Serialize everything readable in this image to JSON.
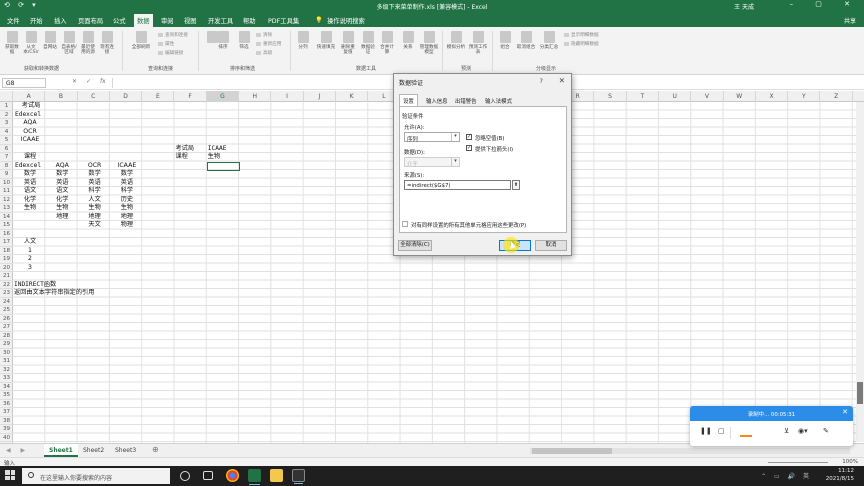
{
  "window": {
    "title": "多级下来菜单制作.xls [兼容模式] - Excel",
    "user": "王 天成",
    "quick_access": "⟲ ⟳ ▾",
    "controls": "– ▢ ✕"
  },
  "menu": {
    "tabs": [
      "文件",
      "开始",
      "插入",
      "页面布局",
      "公式",
      "数据",
      "审阅",
      "视图",
      "开发工具",
      "帮助",
      "PDF工具集"
    ],
    "active_tab": "数据",
    "tell_me": "操作说明搜索",
    "share": "共享"
  },
  "ribbon": {
    "buttons": [
      "获取数据",
      "从文本/CSV",
      "自网站",
      "自表格/区域",
      "最近使用的源",
      "现有连接",
      "全部刷新",
      "排序",
      "筛选",
      "分列",
      "快速填充",
      "删除重复值",
      "数据验证",
      "合并计算",
      "关系",
      "管理数据模型",
      "模拟分析",
      "预测工作表",
      "组合",
      "取消组合",
      "分类汇总"
    ],
    "small_items": [
      "查询和连接",
      "属性",
      "编辑链接",
      "清除",
      "重新应用",
      "高级",
      "显示明细数据",
      "隐藏明细数据"
    ],
    "groups": [
      "获取和转换数据",
      "查询和连接",
      "排序和筛选",
      "数据工具",
      "预测",
      "分级显示"
    ]
  },
  "formula_bar": {
    "name_box": "G8",
    "cancel": "✕",
    "enter": "✓",
    "fx": "fx",
    "content": ""
  },
  "grid": {
    "columns": [
      "A",
      "B",
      "C",
      "D",
      "E",
      "F",
      "G",
      "H",
      "I",
      "J",
      "K",
      "L",
      "M",
      "N",
      "O",
      "P",
      "Q",
      "R",
      "S",
      "T",
      "U",
      "V",
      "W",
      "X",
      "Y",
      "Z"
    ],
    "selected_column": "G",
    "rows": [
      "1",
      "2",
      "3",
      "4",
      "5",
      "6",
      "7",
      "8",
      "9",
      "10",
      "11",
      "12",
      "13",
      "14",
      "15",
      "16",
      "17",
      "18",
      "19",
      "20",
      "21",
      "22",
      "23",
      "24",
      "25",
      "26",
      "27",
      "28",
      "29",
      "30",
      "31",
      "32",
      "33",
      "34",
      "35",
      "36",
      "37",
      "38",
      "39",
      "40"
    ],
    "cells": {
      "A1": "考试局",
      "A2": "Edexcel",
      "A3": "AQA",
      "A4": "OCR",
      "A5": "ICAAE",
      "A7": "课程",
      "A8": "Edexcel",
      "B8": "AQA",
      "C8": "OCR",
      "D8": "ICAAE",
      "A9": "数学",
      "B9": "数学",
      "C9": "数学",
      "D9": "数学",
      "A10": "英语",
      "B10": "英语",
      "C10": "英语",
      "D10": "英语",
      "A11": "语文",
      "B11": "语文",
      "C11": "科学",
      "D11": "科学",
      "A12": "化学",
      "B12": "化学",
      "C12": "人文",
      "D12": "历史",
      "A13": "生物",
      "B13": "生物",
      "C13": "生物",
      "D13": "生物",
      "B14": "地理",
      "C14": "地理",
      "D14": "地理",
      "C15": "天文",
      "D15": "物理",
      "A17": "人文",
      "A18": "1",
      "A19": "2",
      "A20": "3",
      "A22": "INDIRECT函数",
      "A23": "返回由文本字符串指定的引用",
      "F6": "考试局",
      "G6": "ICAAE",
      "F7": "课程",
      "G7": "生物"
    }
  },
  "sheets": {
    "tabs": [
      "Sheet1",
      "Sheet2",
      "Sheet3"
    ],
    "active": "Sheet1",
    "add": "⊕",
    "nav": "◀ ▶"
  },
  "status": {
    "mode": "输入",
    "zoom": "100%"
  },
  "dialog": {
    "title": "数据验证",
    "help": "?",
    "close": "✕",
    "tabs": [
      "设置",
      "输入信息",
      "出错警告",
      "输入法模式"
    ],
    "active_tab": "设置",
    "section_label": "验证条件",
    "allow_label": "允许(A):",
    "allow_value": "序列",
    "ignore_blank_label": "忽略空值(B)",
    "ignore_blank": true,
    "dropdown_label": "提供下拉箭头(I)",
    "dropdown": true,
    "data_label": "数据(D):",
    "data_value": "介于",
    "source_label": "来源(S):",
    "source_value": "=indirect($G$7)",
    "apply_all_label": "对有同样设置的所有其他单元格应用这些更改(P)",
    "apply_all": false,
    "clear_all": "全部清除(C)",
    "ok": "确定",
    "cancel": "取消"
  },
  "recorder": {
    "status": "录制中... 00:05:31",
    "close": "✕"
  },
  "taskbar": {
    "search_placeholder": "在这里输入你要搜索的内容",
    "time": "11:12",
    "date": "2021/8/15",
    "tray": "⌃ ▭ 🔊 英"
  },
  "colors": {
    "excel_green": "#217346",
    "selection_border": "#217346",
    "recorder_blue": "#2b8de8",
    "taskbar": "#1f1f1f"
  }
}
